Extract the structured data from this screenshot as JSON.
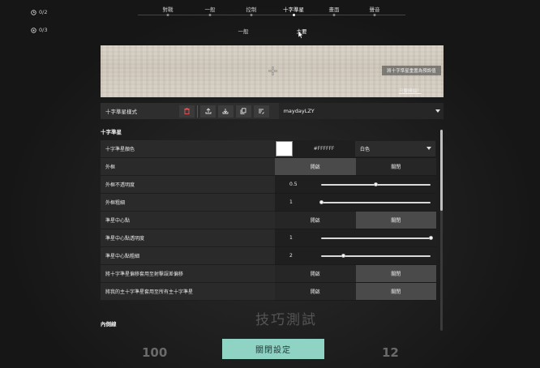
{
  "stats": {
    "timer": "0/2",
    "kills": "0/3"
  },
  "top_tabs": [
    {
      "label": "對戰",
      "active": false
    },
    {
      "label": "一般",
      "active": false
    },
    {
      "label": "控制",
      "active": false
    },
    {
      "label": "十字準星",
      "active": true
    },
    {
      "label": "畫面",
      "active": false
    },
    {
      "label": "聲音",
      "active": false
    }
  ],
  "sub_tabs": [
    {
      "label": "一般",
      "active": false
    },
    {
      "label": "主要",
      "active": true
    }
  ],
  "preview": {
    "button_label": "將十字準星重置為預設值",
    "link_label": "只要開個？"
  },
  "profile": {
    "label": "十字準星樣式",
    "selected": "maydayLZY"
  },
  "section_title": "十字準星",
  "rows": {
    "color": {
      "label": "十字準星顏色",
      "hex": "#FFFFFF",
      "select": "白色",
      "swatch": "#ffffff"
    },
    "outline": {
      "label": "外框",
      "on": "開啟",
      "off": "關閉",
      "selected": "on"
    },
    "outline_opacity": {
      "label": "外框不透明度",
      "value": "0.5",
      "fraction": 0.5
    },
    "outline_thickness": {
      "label": "外框粗細",
      "value": "1",
      "fraction": 0.0
    },
    "center_dot": {
      "label": "準星中心點",
      "on": "開啟",
      "off": "關閉",
      "selected": "off"
    },
    "center_dot_opacity": {
      "label": "準星中心點透明度",
      "value": "1",
      "fraction": 1.0
    },
    "center_dot_thickness": {
      "label": "準星中心點粗細",
      "value": "2",
      "fraction": 0.2
    },
    "fire_error_offset": {
      "label": "將十字準星偏移套用至射擊誤差偏移",
      "on": "開啟",
      "off": "關閉",
      "selected": "off"
    },
    "apply_all": {
      "label": "將我的主十字準星套用至所有主十字準星",
      "on": "開啟",
      "off": "關閉",
      "selected": "off"
    }
  },
  "inner_lines_title": "內側線",
  "scroll_fraction": 0.0,
  "close_button": "關閉設定",
  "background": {
    "left_number": "100",
    "right_number": "12",
    "center_text": "技巧測試"
  },
  "colors": {
    "accent": "#8fd3c4",
    "panel": "#2a2a2a",
    "active_segment": "#4a4a4a"
  }
}
